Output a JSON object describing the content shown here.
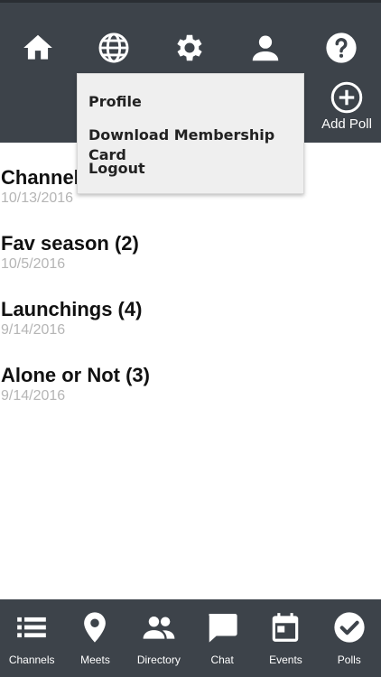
{
  "header": {
    "icons": [
      "home-icon",
      "globe-icon",
      "gear-icon",
      "person-icon",
      "help-icon"
    ],
    "add_poll_label": "Add Poll"
  },
  "menu": {
    "items": [
      "Profile",
      "Download Membership Card",
      "Logout"
    ]
  },
  "polls": [
    {
      "title": "Channel",
      "date": "10/13/2016"
    },
    {
      "title": "Fav season (2)",
      "date": "10/5/2016"
    },
    {
      "title": "Launchings (4)",
      "date": "9/14/2016"
    },
    {
      "title": "Alone or Not (3)",
      "date": "9/14/2016"
    }
  ],
  "tabs": [
    {
      "label": "Channels",
      "icon": "list-icon"
    },
    {
      "label": "Meets",
      "icon": "location-pin-icon"
    },
    {
      "label": "Directory",
      "icon": "people-icon"
    },
    {
      "label": "Chat",
      "icon": "chat-bubble-icon"
    },
    {
      "label": "Events",
      "icon": "calendar-icon"
    },
    {
      "label": "Polls",
      "icon": "check-circle-icon"
    }
  ],
  "colors": {
    "bar": "#3d434a",
    "menu_bg": "#efefef",
    "date_text": "#b5b5b5"
  }
}
